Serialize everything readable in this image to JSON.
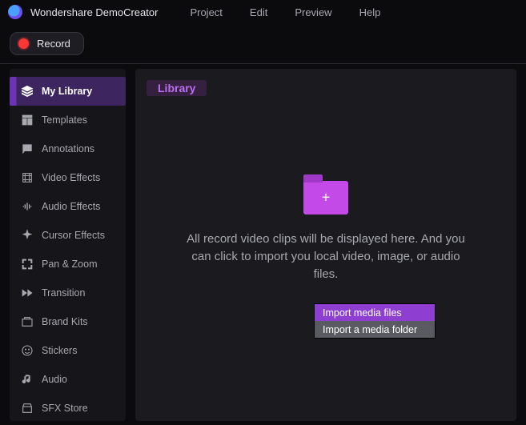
{
  "app": {
    "title": "Wondershare DemoCreator",
    "menu": {
      "project": "Project",
      "edit": "Edit",
      "preview": "Preview",
      "help": "Help"
    }
  },
  "toolbar": {
    "record": "Record"
  },
  "sidebar": {
    "items": [
      {
        "label": "My Library"
      },
      {
        "label": "Templates"
      },
      {
        "label": "Annotations"
      },
      {
        "label": "Video Effects"
      },
      {
        "label": "Audio Effects"
      },
      {
        "label": "Cursor Effects"
      },
      {
        "label": "Pan & Zoom"
      },
      {
        "label": "Transition"
      },
      {
        "label": "Brand Kits"
      },
      {
        "label": "Stickers"
      },
      {
        "label": "Audio"
      },
      {
        "label": "SFX Store"
      }
    ]
  },
  "content": {
    "tag": "Library",
    "empty_msg": "All record video clips will be displayed here. And you can click to import you local video, image, or audio files."
  },
  "context_menu": {
    "import_files": "Import media files",
    "import_folder": "Import a media folder"
  }
}
